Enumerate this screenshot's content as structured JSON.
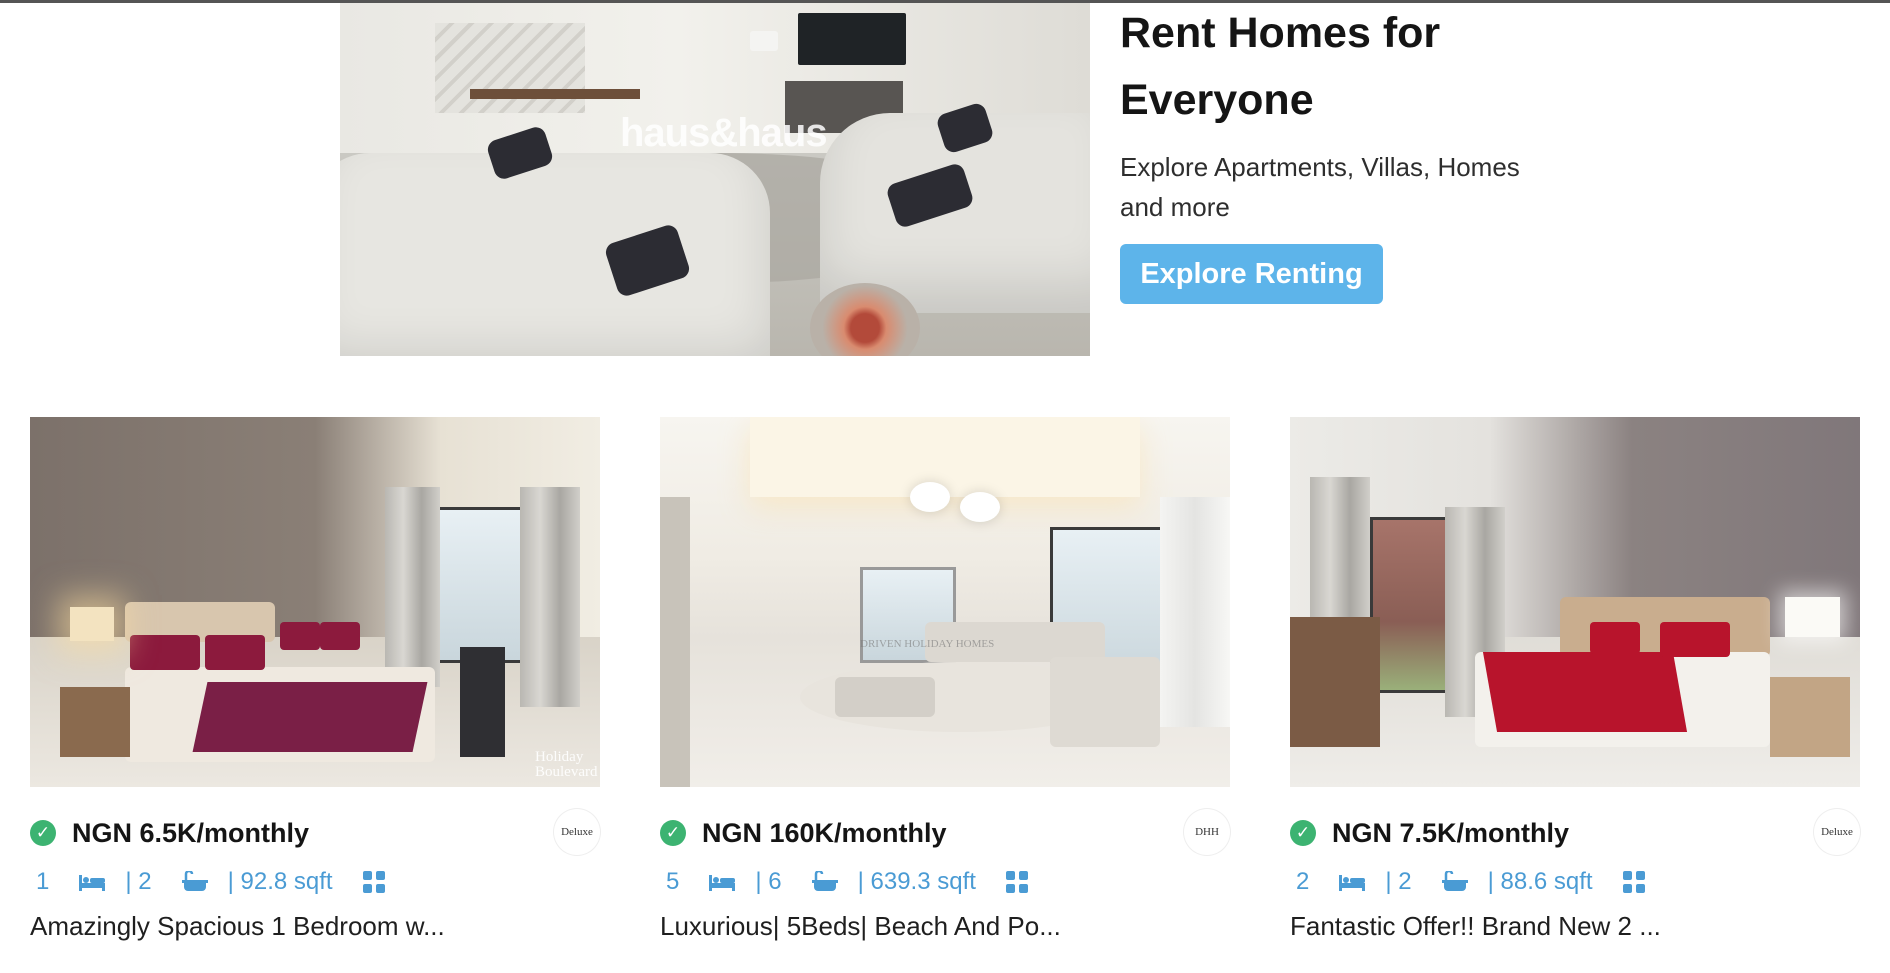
{
  "hero": {
    "title": "Rent Homes for Everyone",
    "subtitle": "Explore Apartments, Villas, Homes and more",
    "button_label": "Explore Renting",
    "image_watermark": "haus&haus"
  },
  "listings": [
    {
      "price": "NGN 6.5K/monthly",
      "beds": "1",
      "baths": "| 2",
      "area": "| 92.8 sqft",
      "title": "Amazingly Spacious 1 Bedroom w...",
      "image_watermark": "Holiday Boulevard",
      "agency_logo": "Deluxe"
    },
    {
      "price": "NGN 160K/monthly",
      "beds": "5",
      "baths": "| 6",
      "area": "| 639.3 sqft",
      "title": "Luxurious| 5Beds| Beach And Po...",
      "image_watermark": "DRIVEN HOLIDAY HOMES",
      "agency_logo": "DHH"
    },
    {
      "price": "NGN 7.5K/monthly",
      "beds": "2",
      "baths": "| 2",
      "area": "| 88.6 sqft",
      "title": "Fantastic Offer!! Brand New 2 ...",
      "agency_logo": "Deluxe"
    }
  ],
  "icons": {
    "verified": "check-circle-icon",
    "beds": "bed-icon",
    "baths": "bath-icon",
    "layout": "grid-icon"
  },
  "colors": {
    "accent": "#5db4ea",
    "spec_text": "#4a9bd4",
    "verified": "#3cb371"
  }
}
